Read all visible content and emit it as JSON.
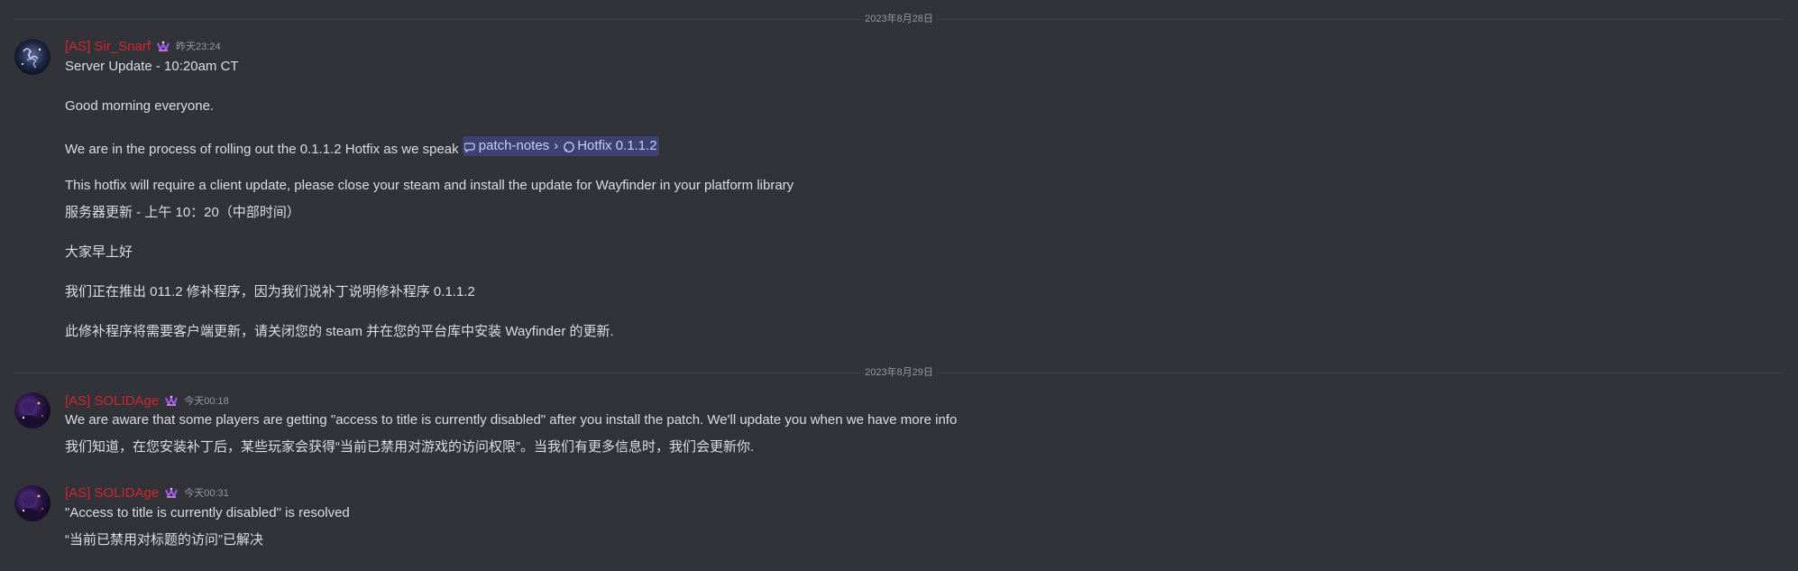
{
  "dividers": [
    {
      "date": "2023年8月28日"
    },
    {
      "date": "2023年8月29日"
    }
  ],
  "messages": [
    {
      "author": "[AS] Sir_Snarf",
      "timestamp": "昨天23:24",
      "lines": {
        "l1": "Server Update - 10:20am CT",
        "l2": "Good morning everyone.",
        "l3_prefix": "We are in the process of rolling out the 0.1.1.2 Hotfix as we speak ",
        "mention_channel": "patch-notes",
        "mention_sep": "›",
        "mention_thread": "Hotfix 0.1.1.2",
        "l4": "This hotfix will require a client update, please close your steam and install the update for Wayfinder in your platform library",
        "l5": "服务器更新 - 上午 10：20（中部时间）",
        "l6": "大家早上好",
        "l7": "我们正在推出 011.2 修补程序，因为我们说补丁说明修补程序 0.1.1.2",
        "l8": "此修补程序将需要客户端更新，请关闭您的 steam 并在您的平台库中安装 Wayfinder 的更新."
      }
    },
    {
      "author": "[AS] SOLIDAge",
      "timestamp": "今天00:18",
      "lines": {
        "l1": "We are aware that some players are getting \"access to title is currently disabled\" after you install the patch. We'll update you when we have more info",
        "l2": "我们知道，在您安装补丁后，某些玩家会获得“当前已禁用对游戏的访问权限”。当我们有更多信息时，我们会更新你."
      }
    },
    {
      "author": "[AS] SOLIDAge",
      "timestamp": "今天00:31",
      "lines": {
        "l1": "\"Access to title is currently disabled\" is resolved",
        "l2": "“当前已禁用对标题的访问”已解决"
      }
    }
  ],
  "colors": {
    "background": "#313338",
    "username": "#d1262f",
    "text": "#dbdee1",
    "muted": "#949ba4",
    "mention_bg": "rgba(88,101,242,0.3)"
  },
  "icons": {
    "badge": "hypesquad-badge-icon",
    "channel": "forum-channel-icon",
    "thread": "thread-icon"
  }
}
